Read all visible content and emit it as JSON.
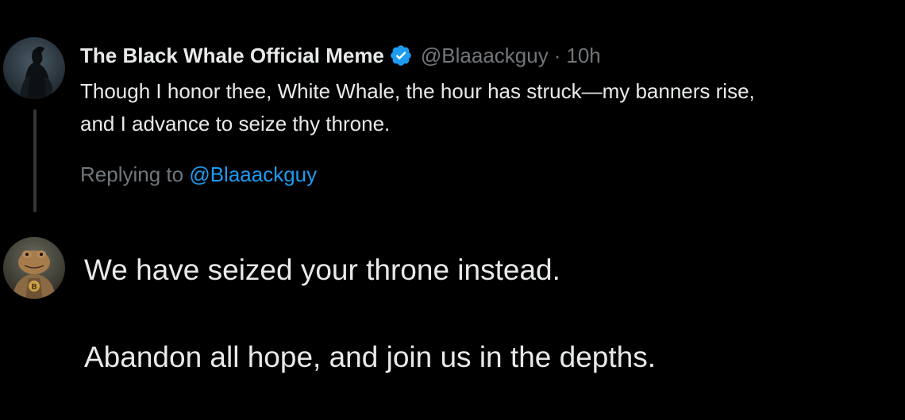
{
  "original_tweet": {
    "avatar_icon": "dark-knight-avatar-icon",
    "display_name": "The Black Whale Official Meme",
    "verified_badge_color": "#1d9bf0",
    "handle": "@Blaaackguy",
    "separator": "·",
    "time": "10h",
    "text_lines": [
      "Though I honor thee, White Whale, the hour has struck—my banners rise,",
      "and I advance to seize thy throne."
    ],
    "replying_prefix": "Replying to",
    "replying_mention": "@Blaaackguy"
  },
  "reply": {
    "avatar_icon": "frog-with-bitcoin-avatar-icon",
    "paragraphs": [
      "We have seized your throne instead.",
      "Abandon all hope, and join us in the depths."
    ]
  },
  "colors": {
    "background": "#000000",
    "primary_text": "#e7e9ea",
    "secondary_text": "#71767b",
    "link": "#1d9bf0",
    "thread_line": "#333639"
  }
}
